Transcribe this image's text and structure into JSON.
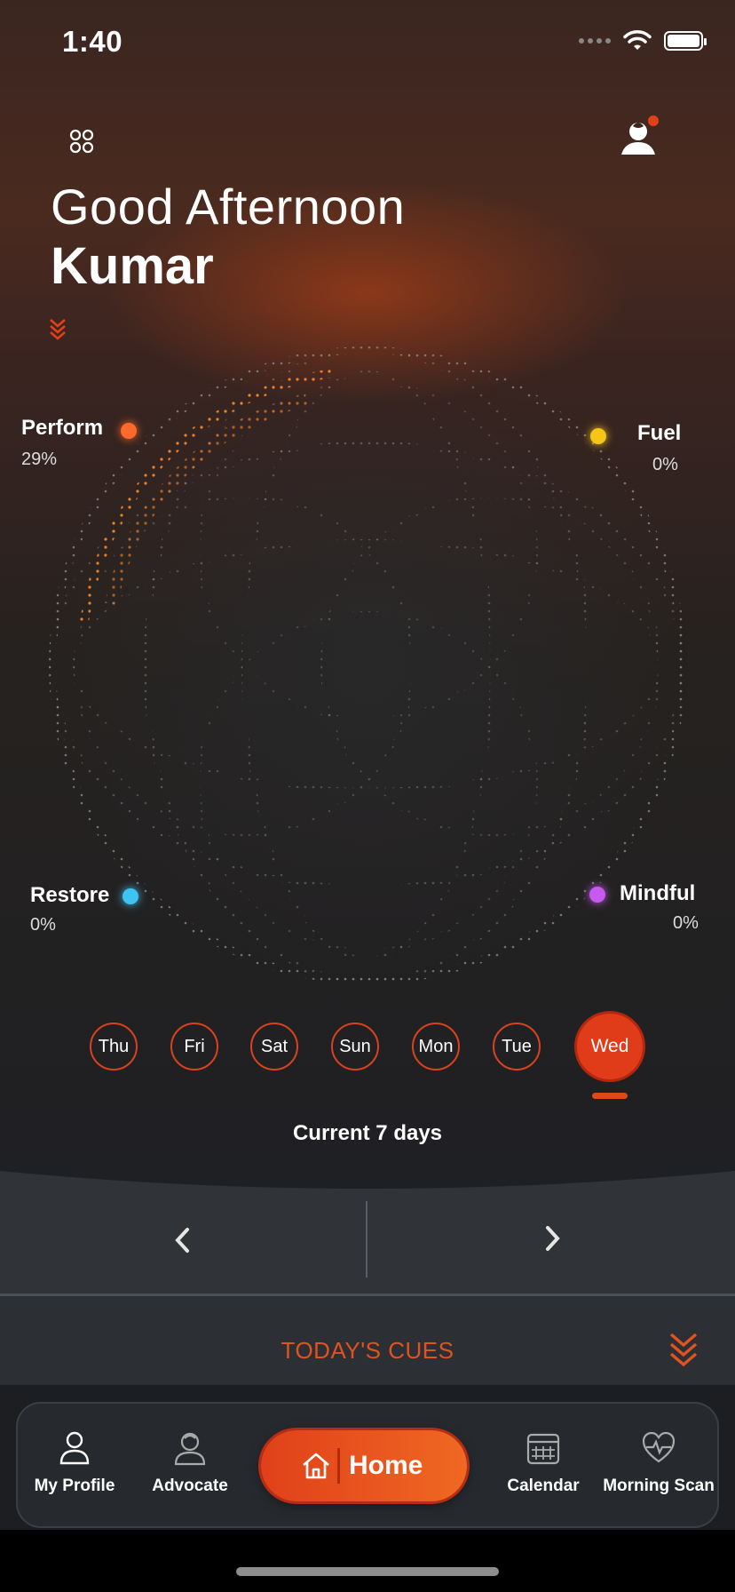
{
  "status_bar": {
    "time": "1:40"
  },
  "greeting": {
    "line1": "Good Afternoon",
    "name": "Kumar"
  },
  "metrics": {
    "perform": {
      "label": "Perform",
      "value": "29%",
      "color": "#ff6a2a"
    },
    "fuel": {
      "label": "Fuel",
      "value": "0%",
      "color": "#f5c518"
    },
    "restore": {
      "label": "Restore",
      "value": "0%",
      "color": "#3fc3f2"
    },
    "mindful": {
      "label": "Mindful",
      "value": "0%",
      "color": "#c858f0"
    }
  },
  "days": [
    "Thu",
    "Fri",
    "Sat",
    "Sun",
    "Mon",
    "Tue",
    "Wed"
  ],
  "selected_day": "Wed",
  "period_label": "Current 7 days",
  "cues": {
    "title": "TODAY'S CUES"
  },
  "tabs": {
    "my_profile": "My Profile",
    "advocate": "Advocate",
    "home": "Home",
    "calendar": "Calendar",
    "morning_scan": "Morning Scan"
  },
  "colors": {
    "accent": "#e0401a",
    "background": "#1d1e22"
  }
}
